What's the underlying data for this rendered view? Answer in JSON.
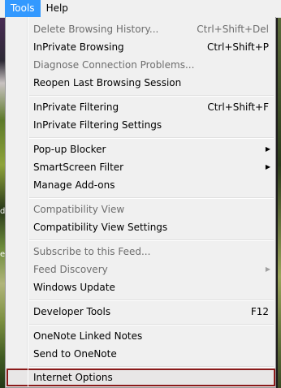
{
  "menubar": {
    "tools": "Tools",
    "help": "Help"
  },
  "background": {
    "snippet_d": "d",
    "snippet_es": "es"
  },
  "menu": {
    "delete_history": {
      "label": "Delete Browsing History...",
      "shortcut": "Ctrl+Shift+Del"
    },
    "inprivate_browsing": {
      "label": "InPrivate Browsing",
      "shortcut": "Ctrl+Shift+P"
    },
    "diagnose": {
      "label": "Diagnose Connection Problems..."
    },
    "reopen_session": {
      "label": "Reopen Last Browsing Session"
    },
    "inprivate_filtering": {
      "label": "InPrivate Filtering",
      "shortcut": "Ctrl+Shift+F"
    },
    "inprivate_filtering_settings": {
      "label": "InPrivate Filtering Settings"
    },
    "popup_blocker": {
      "label": "Pop-up Blocker"
    },
    "smartscreen": {
      "label": "SmartScreen Filter"
    },
    "manage_addons": {
      "label": "Manage Add-ons"
    },
    "compat_view": {
      "label": "Compatibility View"
    },
    "compat_view_settings": {
      "label": "Compatibility View Settings"
    },
    "subscribe_feed": {
      "label": "Subscribe to this Feed..."
    },
    "feed_discovery": {
      "label": "Feed Discovery"
    },
    "windows_update": {
      "label": "Windows Update"
    },
    "developer_tools": {
      "label": "Developer Tools",
      "shortcut": "F12"
    },
    "onenote_linked": {
      "label": "OneNote Linked Notes"
    },
    "send_onenote": {
      "label": "Send to OneNote"
    },
    "internet_options": {
      "label": "Internet Options"
    }
  },
  "icons": {
    "submenu_arrow": "chevron-right-icon"
  },
  "colors": {
    "active_menu": "#3399ff",
    "highlight_border": "#8b1a1a",
    "menu_bg": "#f0f0f0"
  }
}
